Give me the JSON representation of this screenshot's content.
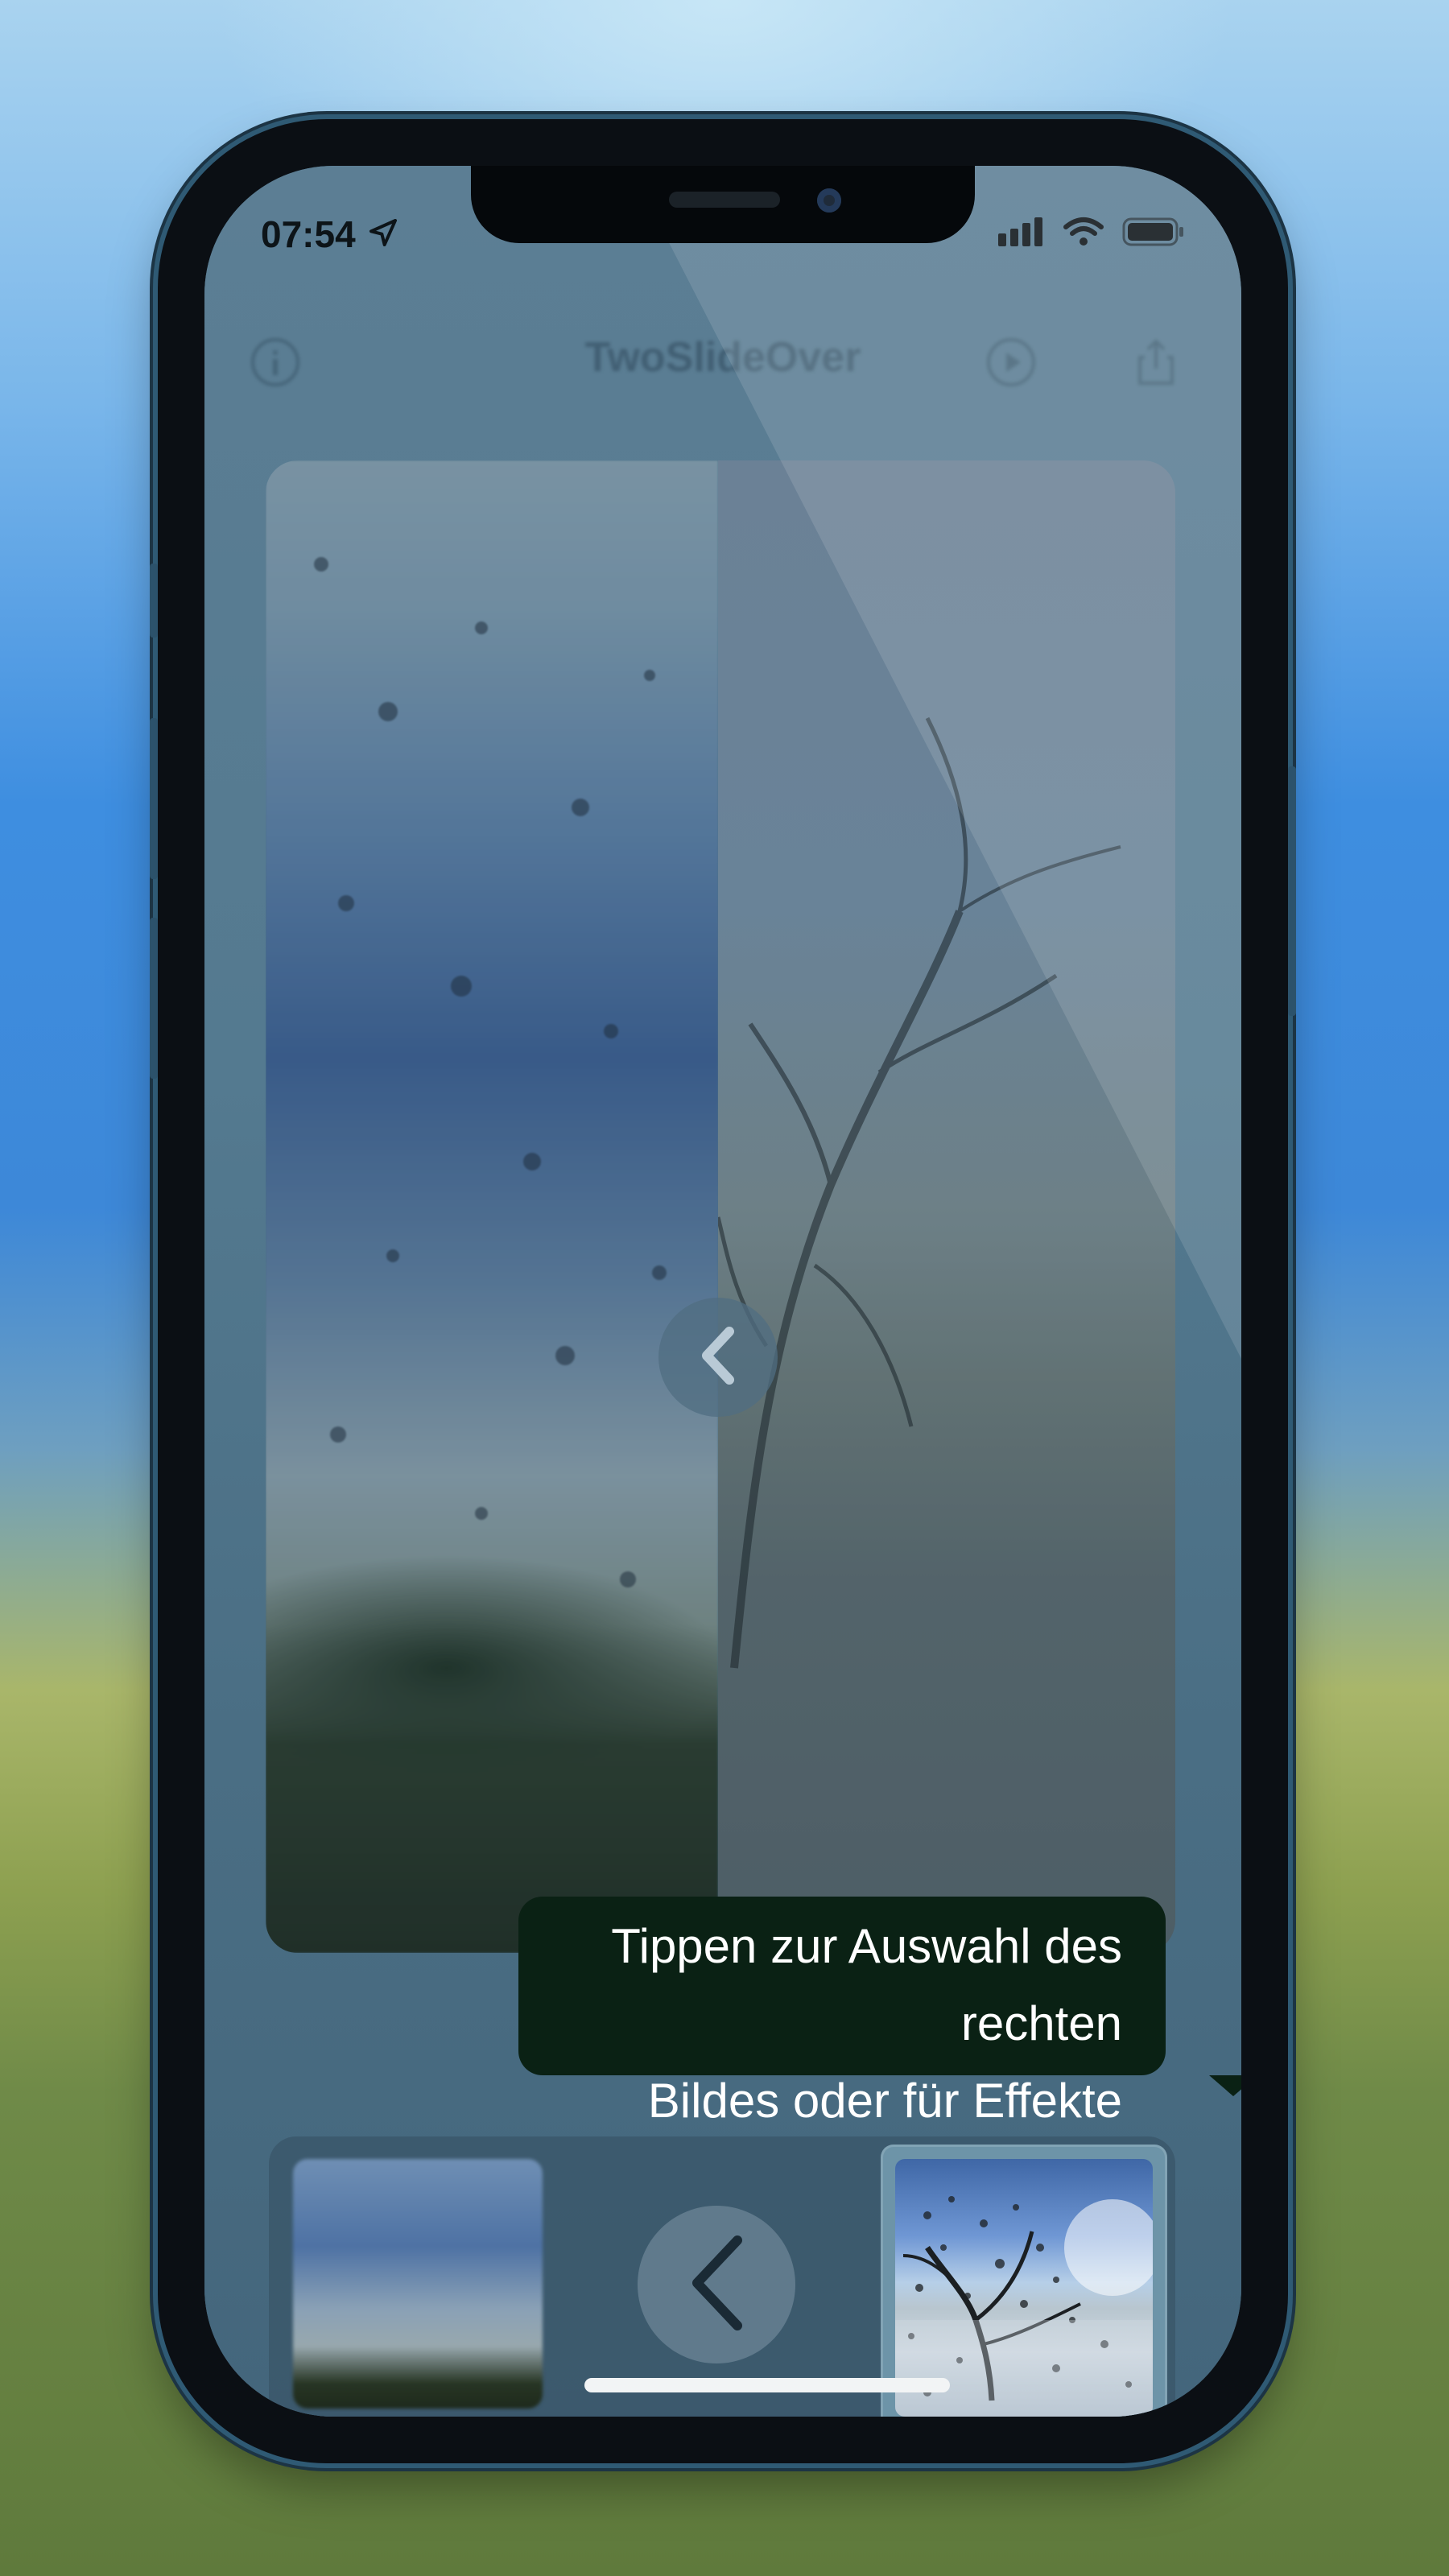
{
  "status_bar": {
    "time": "07:54",
    "icons": [
      "location-arrow-icon",
      "signal-bars-icon",
      "wifi-icon",
      "battery-icon"
    ]
  },
  "nav": {
    "title": "TwoSlideOver",
    "icons": [
      "info-icon",
      "play-icon",
      "share-icon"
    ]
  },
  "compare": {
    "divider_icon": "chevron-left-icon"
  },
  "tooltip": {
    "line1": "Tippen zur Auswahl des rechten",
    "line2": "Bildes oder für Effekte"
  },
  "thumbnails": {
    "center_icon": "chevron-left-icon",
    "selected": "right"
  },
  "colors": {
    "tooltip_bg": "#0a2114",
    "tooltip_text": "#ffffff"
  }
}
